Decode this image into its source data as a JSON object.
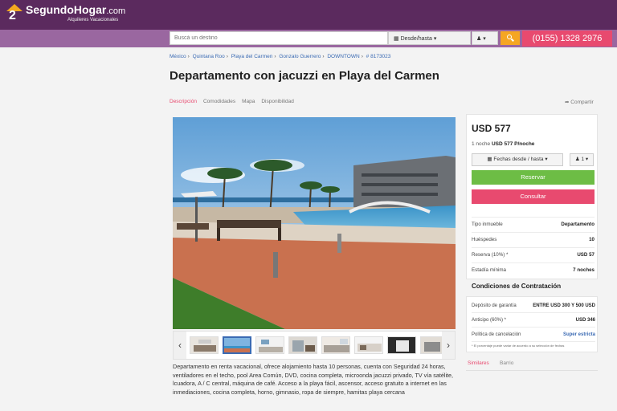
{
  "header": {
    "logo_number": "2",
    "logo_name": "SegundoHogar",
    "logo_tld": ".com",
    "logo_tagline": "Alquileres Vacacionales"
  },
  "search": {
    "placeholder": "Buscá un destino",
    "dates_label": "Desde/hasta",
    "guests_label": "",
    "phone": "(0155) 1328 2976"
  },
  "breadcrumb": [
    "México",
    "Quintana Roo",
    "Playa del Carmen",
    "Gonzalo Guerrero",
    "DOWNTOWN",
    "# 8173023"
  ],
  "title": "Departamento con jacuzzi en Playa del Carmen",
  "tabs": [
    "Descripción",
    "Comodidades",
    "Mapa",
    "Disponibilidad"
  ],
  "share_label": "Compartir",
  "thumbnail_count": 8,
  "selected_thumbnail": 2,
  "description": "Departamento en renta vacacional, ofrece alojamiento hasta 10 personas, cuenta con Seguridad 24 horas, ventiladores en el techo, pool Area Común, DVD, cocina completa, microonda jacuzzi privado, TV vía satélite, lcuadora, A / C central, máquina de café. Acceso a la playa fácil, ascensor, acceso gratuito a internet en las inmediaciones, cocina completa, horno, gimnasio, ropa de siempre, hamitas playa cercana",
  "booking": {
    "price": "USD 577",
    "nights_prefix": "1 noche",
    "nights_value": "USD 577 P/noche",
    "dates_button": "Fechas desde / hasta",
    "guests_button": "1",
    "reserve_button": "Reservar",
    "consult_button": "Consultar",
    "info": [
      {
        "label": "Tipo inmueble",
        "value": "Departamento"
      },
      {
        "label": "Huéspedes",
        "value": "10"
      },
      {
        "label": "Reserva (10%) *",
        "value": "USD 57"
      },
      {
        "label": "Estadía mínima",
        "value": "7 noches"
      }
    ]
  },
  "conditions": {
    "title": "Condiciones de Contratación",
    "rows": [
      {
        "label": "Depósito de garantía",
        "value": "ENTRE USD 300 Y 500 USD"
      },
      {
        "label": "Anticipo (60%) *",
        "value": "USD 346"
      },
      {
        "label": "Política de cancelación",
        "value": "Super estricta"
      }
    ],
    "note": "* El porcentaje puede variar de acuerdo a su selección de fechas"
  },
  "bottom_tabs": [
    "Similares",
    "Barrio"
  ],
  "colors": {
    "header": "#5b2a5e",
    "searchbar": "#9a67a0",
    "accent_pink": "#e84a6f",
    "accent_green": "#6dbd45",
    "accent_orange": "#f5a623",
    "link_blue": "#3a6ab3"
  }
}
